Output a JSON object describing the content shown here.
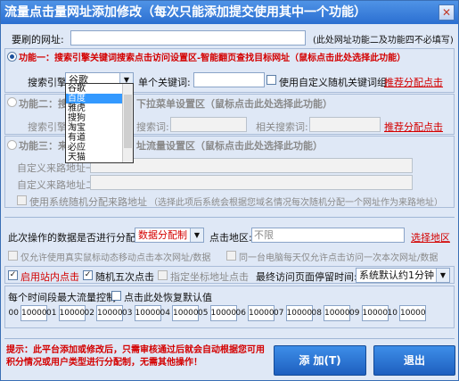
{
  "title": "流量点击量网址添加修改（每次只能添加提交使用其中一个功能）",
  "url_row": {
    "label": "要刷的网址:",
    "value": "",
    "note": "(此处网址功能二及功能四不必填写)"
  },
  "feature1": {
    "label": "功能一：搜索引擎关键词搜索点击访问设置区-智能翻页查找目标网址（鼠标点击此处选择此功能）",
    "engine_label": "搜索引擎:",
    "engine_value": "谷歌",
    "keyword_label": "单个关键词:",
    "keyword_value": "",
    "custom_random_label": "使用自定义随机关键词组",
    "recommend_link": "推荐分配点击",
    "dropdown_options": [
      "谷歌",
      "百度",
      "雅虎",
      "搜狗",
      "淘宝",
      "有道",
      "必应",
      "天猫"
    ]
  },
  "feature2": {
    "label_a": "功能二：搜",
    "label_b": "下拉菜单设置区（鼠标点击此处选择此功能）",
    "engine_label": "搜索引擎:",
    "search_word_label": "搜索词:",
    "related_label": "相关搜索词:",
    "recommend_link": "推荐分配点击"
  },
  "feature3": {
    "label_a": "功能三：来",
    "label_b": "址流量设置区（鼠标点击此处选择此功能）",
    "source1_label": "自定义来路地址一:",
    "source2_label": "自定义来路地址二:",
    "system_label": "使用系统随机分配来路地址",
    "system_note": "（选择此项后系统会根据您域名情况每次随机分配一个网址作为来路地址）"
  },
  "assign": {
    "label": "此次操作的数据是否进行分配制:",
    "value": "数据分配制",
    "region_label": "点击地区:",
    "region_value": "不限",
    "region_link": "选择地区"
  },
  "options": {
    "real_mouse": "仅允许使用真实鼠标动态移动点击本次网址/数据",
    "same_pc": "同一台电脑每天仅允许点击访问一次本次网址/数据",
    "enable_inner_click": "启用站内点击",
    "random_five": "随机五次点击",
    "specify_subpage": "指定坐标地址点击",
    "final_stay_label": "最终访问页面停留时间:",
    "final_stay_value": "系统默认约1分钟"
  },
  "hourly": {
    "label": "每个时间段最大流量控制",
    "reset_label": "点击此处恢复默认值",
    "hours": [
      "00",
      "01",
      "02",
      "03",
      "04",
      "05",
      "06",
      "07",
      "08",
      "09",
      "10",
      "11",
      "12",
      "13",
      "14",
      "15",
      "16",
      "17",
      "18",
      "19",
      "20",
      "21",
      "22",
      "23"
    ],
    "values": [
      "10000",
      "10000",
      "10000",
      "10000",
      "10000",
      "10000",
      "10000",
      "10000",
      "10000",
      "10000",
      "10000",
      "10000",
      "10000",
      "10000",
      "10000",
      "10000",
      "10000",
      "10000",
      "10000",
      "10000",
      "10000",
      "10000",
      "10000",
      "10000"
    ]
  },
  "tip": "提示：此平台添加或修改后，只需审核通过后就会自动根据您可用积分情况或用户类型进行分配制，无需其他操作！",
  "buttons": {
    "add": "添 加(T)",
    "exit": "退出"
  },
  "colors": {
    "title_bg": "#2b6fd1",
    "window_bg": "#dfe8f6",
    "accent_red": "#d40000",
    "button_blue": "#1e5fbf"
  }
}
